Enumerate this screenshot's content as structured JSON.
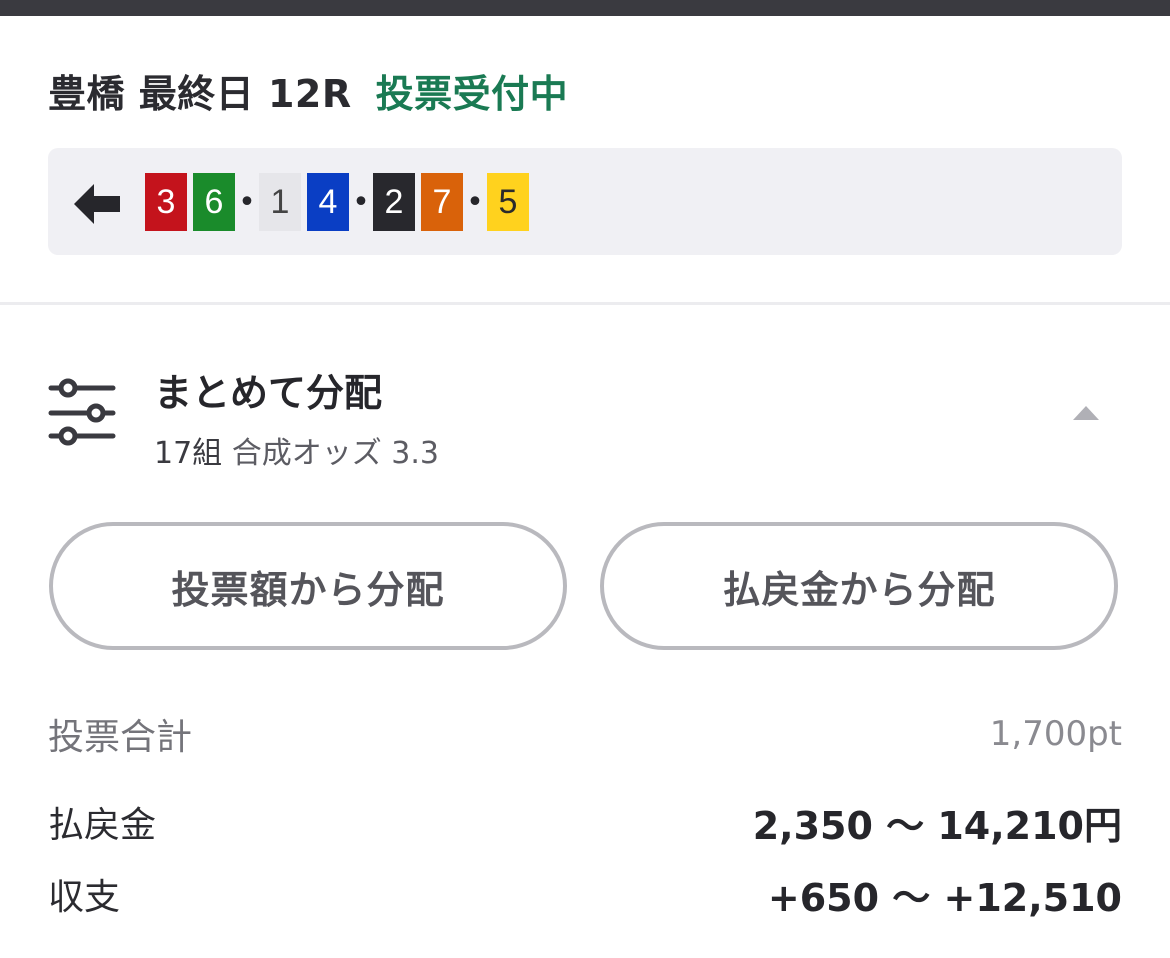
{
  "race": {
    "name": "豊橋 最終日 12R",
    "status": "投票受付中",
    "status_color": "#1a7a53"
  },
  "combination": {
    "back_icon": "back-arrow-icon",
    "items": [
      {
        "type": "chip",
        "value": "3",
        "color": "#c4131c"
      },
      {
        "type": "chip",
        "value": "6",
        "color": "#1a8b2b"
      },
      {
        "type": "sep",
        "value": "•"
      },
      {
        "type": "chip",
        "value": "1",
        "color": "#e6e6ea"
      },
      {
        "type": "chip",
        "value": "4",
        "color": "#0a3ec4"
      },
      {
        "type": "sep",
        "value": "•"
      },
      {
        "type": "chip",
        "value": "2",
        "color": "#28282d"
      },
      {
        "type": "chip",
        "value": "7",
        "color": "#d9620a"
      },
      {
        "type": "sep",
        "value": "•"
      },
      {
        "type": "chip",
        "value": "5",
        "color": "#ffd21e"
      }
    ]
  },
  "distribution": {
    "icon": "sliders-icon",
    "title": "まとめて分配",
    "count": "17組",
    "odds_text": "合成オッズ 3.3",
    "collapse_icon": "caret-up-icon",
    "buttons": {
      "by_bet": "投票額から分配",
      "by_payout": "払戻金から分配"
    }
  },
  "summary": {
    "total_label": "投票合計",
    "total_value": "1,700pt",
    "payout_label": "払戻金",
    "payout_value": "2,350 〜 14,210円",
    "net_label": "収支",
    "net_value": "+650 〜 +12,510"
  }
}
